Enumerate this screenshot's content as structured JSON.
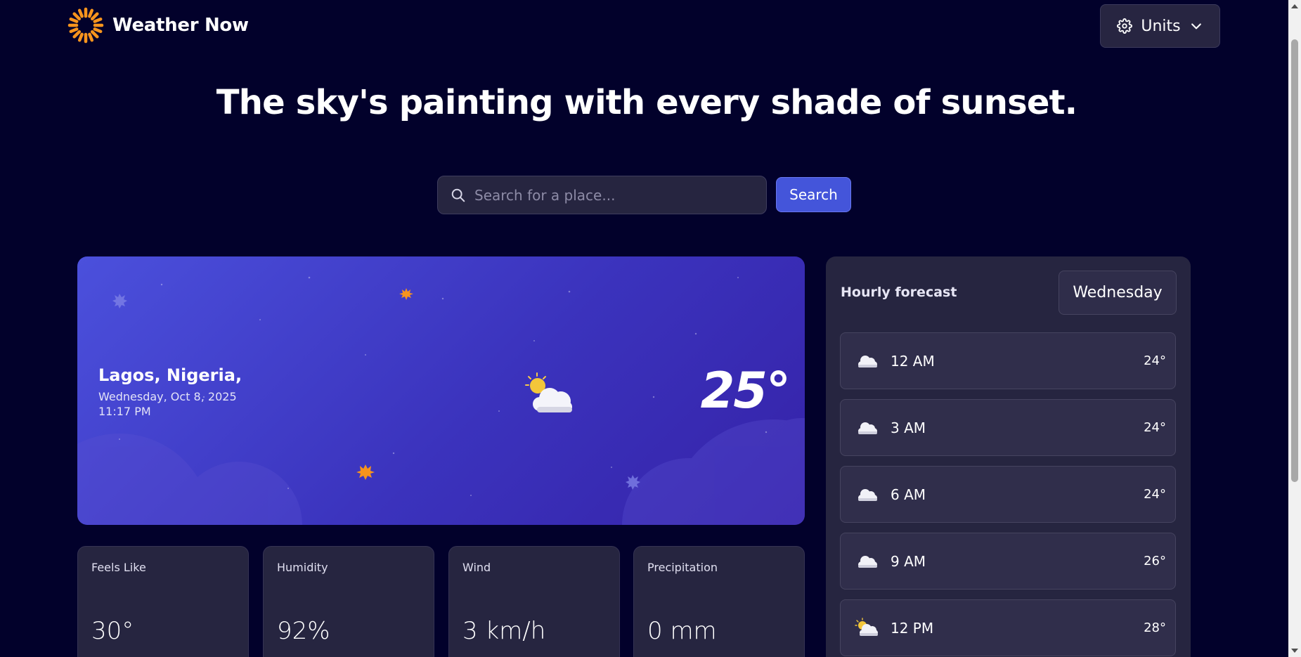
{
  "header": {
    "brand": "Weather Now",
    "units_label": "Units",
    "logo_icon": "sun-logo-icon",
    "settings_icon": "gear-icon",
    "dropdown_icon": "chevron-down-icon"
  },
  "headline": "The sky's painting with every shade of sunset.",
  "search": {
    "placeholder": "Search for a place...",
    "value": "",
    "button_label": "Search",
    "icon": "search-icon"
  },
  "current": {
    "location": "Lagos, Nigeria,",
    "date": "Wednesday, Oct 8, 2025",
    "time": "11:17 PM",
    "temperature": "25°",
    "condition_icon": "partly-cloudy-icon"
  },
  "stats": [
    {
      "label": "Feels Like",
      "value": "30°"
    },
    {
      "label": "Humidity",
      "value": "92%"
    },
    {
      "label": "Wind",
      "value": "3 km/h"
    },
    {
      "label": "Precipitation",
      "value": "0 mm"
    }
  ],
  "hourly": {
    "title": "Hourly forecast",
    "selected_day": "Wednesday",
    "items": [
      {
        "time": "12 AM",
        "temp": "24°",
        "icon": "cloud-icon"
      },
      {
        "time": "3 AM",
        "temp": "24°",
        "icon": "cloud-icon"
      },
      {
        "time": "6 AM",
        "temp": "24°",
        "icon": "cloud-icon"
      },
      {
        "time": "9 AM",
        "temp": "26°",
        "icon": "cloud-icon"
      },
      {
        "time": "12 PM",
        "temp": "28°",
        "icon": "partly-cloudy-icon"
      }
    ]
  },
  "colors": {
    "background": "#02012b",
    "card": "#262540",
    "accent": "#4455da",
    "logo_orange": "#f7941d"
  }
}
